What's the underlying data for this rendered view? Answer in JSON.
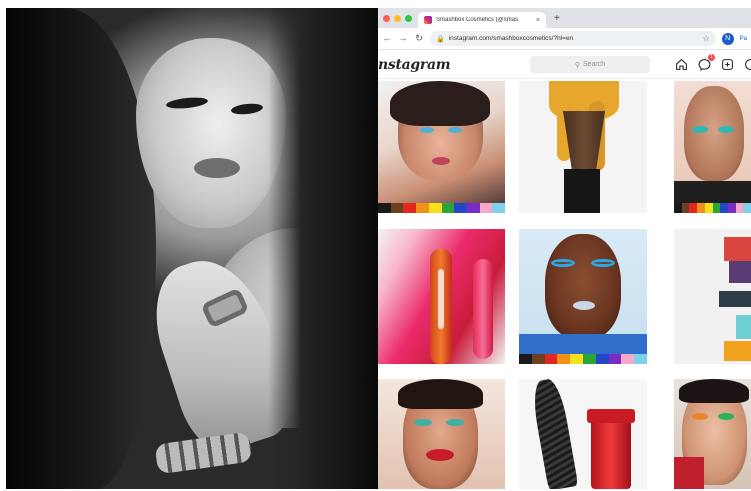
{
  "browser": {
    "tab_title": "Smashbox Cosmetics (@smas",
    "tab_close": "×",
    "new_tab": "+",
    "url": "instagram.com/smashboxcosmetics/?hl=en",
    "profile_initial": "N",
    "profile_label": "Pa"
  },
  "instagram": {
    "logo": "nstagram",
    "search_placeholder": "Search",
    "notification_count": "1"
  },
  "rainbow_stripe": [
    "#1a1a1a",
    "#6b3f1f",
    "#e0281e",
    "#f29118",
    "#f5e21a",
    "#2ca43b",
    "#2446c9",
    "#7a2bc2",
    "#f6a8c8",
    "#7fd0ea"
  ],
  "colors": {
    "traffic_red": "#ff5f57",
    "traffic_yellow": "#febc2e",
    "traffic_green": "#28c840"
  }
}
